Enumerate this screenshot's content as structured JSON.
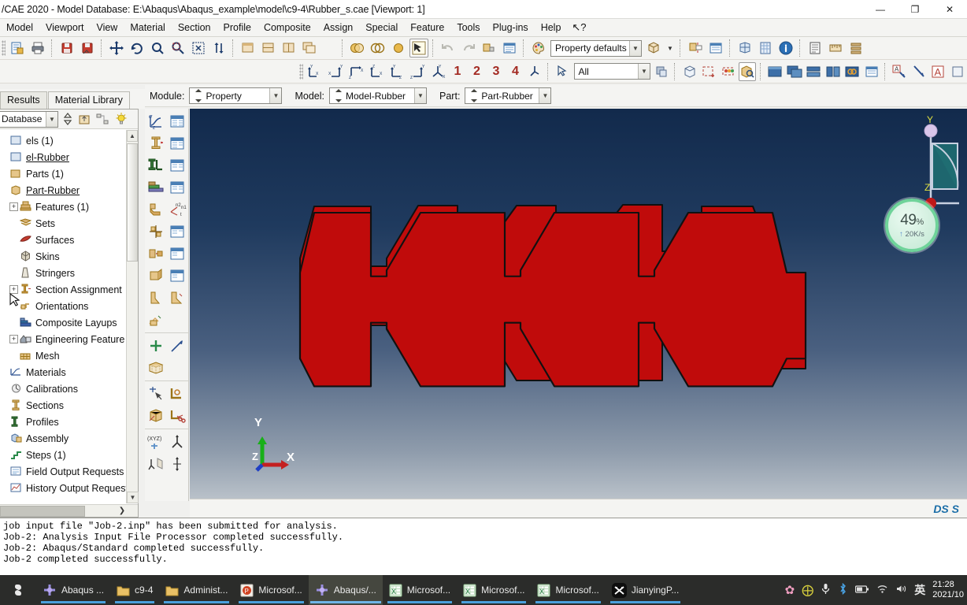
{
  "window": {
    "title": "/CAE 2020 - Model Database: E:\\Abaqus\\Abaqus_example\\model\\c9-4\\Rubber_s.cae [Viewport: 1]",
    "minimize": "—",
    "maximize": "❐",
    "close": "✕"
  },
  "menu": {
    "items": [
      {
        "label": "Model"
      },
      {
        "label": "Viewport"
      },
      {
        "label": "View"
      },
      {
        "label": "Material"
      },
      {
        "label": "Section"
      },
      {
        "label": "Profile"
      },
      {
        "label": "Composite"
      },
      {
        "label": "Assign"
      },
      {
        "label": "Special"
      },
      {
        "label": "Feature"
      },
      {
        "label": "Tools"
      },
      {
        "label": "Plug-ins"
      },
      {
        "label": "Help"
      }
    ],
    "context_help": "↖?"
  },
  "toolbar": {
    "property_defaults": "Property defaults",
    "view_numbers": [
      "1",
      "2",
      "3",
      "4"
    ],
    "selection_filter": "All"
  },
  "module_bar": {
    "module_label": "Module:",
    "module_value": "Property",
    "model_label": "Model:",
    "model_value": "Model-Rubber",
    "part_label": "Part:",
    "part_value": "Part-Rubber"
  },
  "left_tabs": [
    {
      "label": "Results",
      "active": false
    },
    {
      "label": "Material Library",
      "active": true
    }
  ],
  "tree": {
    "selector_value": "Database",
    "items": [
      {
        "label": "els (1)",
        "indent": 0,
        "expander": "",
        "icon": "model-icon",
        "underline": false
      },
      {
        "label": "el-Rubber",
        "indent": 0,
        "expander": "",
        "icon": "model-icon",
        "underline": true
      },
      {
        "label": "Parts (1)",
        "indent": 1,
        "expander": "",
        "icon": "parts-icon",
        "underline": false
      },
      {
        "label": "Part-Rubber",
        "indent": 1,
        "expander": "",
        "icon": "part-icon",
        "underline": true
      },
      {
        "label": "Features (1)",
        "indent": 2,
        "expander": "+",
        "icon": "feature-icon",
        "underline": false
      },
      {
        "label": "Sets",
        "indent": 2,
        "expander": "",
        "icon": "sets-icon",
        "underline": false
      },
      {
        "label": "Surfaces",
        "indent": 2,
        "expander": "",
        "icon": "surfaces-icon",
        "underline": false
      },
      {
        "label": "Skins",
        "indent": 2,
        "expander": "",
        "icon": "skins-icon",
        "underline": false
      },
      {
        "label": "Stringers",
        "indent": 2,
        "expander": "",
        "icon": "stringers-icon",
        "underline": false
      },
      {
        "label": "Section Assignment",
        "indent": 2,
        "expander": "+",
        "icon": "section-assignment-icon",
        "underline": false
      },
      {
        "label": "Orientations",
        "indent": 2,
        "expander": "",
        "icon": "orientations-icon",
        "underline": false
      },
      {
        "label": "Composite Layups",
        "indent": 2,
        "expander": "",
        "icon": "composite-layups-icon",
        "underline": false
      },
      {
        "label": "Engineering Feature",
        "indent": 2,
        "expander": "+",
        "icon": "engineering-features-icon",
        "underline": false
      },
      {
        "label": "Mesh",
        "indent": 2,
        "expander": "",
        "icon": "mesh-icon",
        "underline": false
      },
      {
        "label": "Materials",
        "indent": 1,
        "expander": "",
        "icon": "materials-icon",
        "underline": false
      },
      {
        "label": "Calibrations",
        "indent": 1,
        "expander": "",
        "icon": "calibrations-icon",
        "underline": false
      },
      {
        "label": "Sections",
        "indent": 1,
        "expander": "",
        "icon": "sections-icon",
        "underline": false
      },
      {
        "label": "Profiles",
        "indent": 1,
        "expander": "",
        "icon": "profiles-icon",
        "underline": false
      },
      {
        "label": "Assembly",
        "indent": 1,
        "expander": "",
        "icon": "assembly-icon",
        "underline": false
      },
      {
        "label": "Steps (1)",
        "indent": 1,
        "expander": "",
        "icon": "steps-icon",
        "underline": false
      },
      {
        "label": "Field Output Requests",
        "indent": 1,
        "expander": "",
        "icon": "field-output-icon",
        "underline": false
      },
      {
        "label": "History Output Requests",
        "indent": 1,
        "expander": "",
        "icon": "history-output-icon",
        "underline": false
      }
    ]
  },
  "viewport": {
    "triad": {
      "x": "X",
      "y": "Y",
      "z": "Z"
    },
    "rotate_widget": {
      "y": "Y",
      "z": "Z"
    },
    "model_color": "#c00b0b",
    "model_edge_color": "#101010",
    "status_logo": "DS S"
  },
  "progress_widget": {
    "percent": "49",
    "percent_symbol": "%",
    "rate": "20K/s",
    "arrow": "↑",
    "ring_color": "#6fd39a"
  },
  "messages": [
    "job input file \"Job-2.inp\" has been submitted for analysis.",
    "Job-2: Analysis Input File Processor completed successfully.",
    "Job-2: Abaqus/Standard completed successfully.",
    "Job-2 completed successfully."
  ],
  "taskbar": {
    "items": [
      {
        "label": "Abaqus ...",
        "icon": "abaqus-icon",
        "active": false
      },
      {
        "label": "c9-4",
        "icon": "folder-icon",
        "active": false
      },
      {
        "label": "Administ...",
        "icon": "folder-icon",
        "active": false
      },
      {
        "label": "Microsof...",
        "icon": "powerpoint-icon",
        "active": false
      },
      {
        "label": "Abaqus/...",
        "icon": "abaqus-icon",
        "active": true
      },
      {
        "label": "Microsof...",
        "icon": "excel-icon",
        "active": false
      },
      {
        "label": "Microsof...",
        "icon": "excel-icon",
        "active": false
      },
      {
        "label": "Microsof...",
        "icon": "excel-icon",
        "active": false
      },
      {
        "label": "JianyingP...",
        "icon": "jianying-icon",
        "active": false
      }
    ],
    "tray": [
      {
        "name": "sakura-icon",
        "glyph": "✿",
        "color": "#f09ec0"
      },
      {
        "name": "plus-circle-icon",
        "glyph": "⊕",
        "color": "#d8d040"
      },
      {
        "name": "microphone-icon",
        "glyph": "Ἲ4",
        "color": "#dddddd"
      },
      {
        "name": "bluetooth-icon",
        "glyph": "ᛗ",
        "color": "#4aa5e8"
      },
      {
        "name": "battery-icon",
        "glyph": "▭",
        "color": "#e0e0e0"
      },
      {
        "name": "wifi-icon",
        "glyph": "◜",
        "color": "#dddddd"
      },
      {
        "name": "volume-icon",
        "glyph": "ὐA",
        "color": "#e0e0e0"
      },
      {
        "name": "ime-icon",
        "glyph": "英",
        "color": "#ffffff"
      }
    ],
    "clock_time": "21:28",
    "clock_date": "2021/10"
  }
}
